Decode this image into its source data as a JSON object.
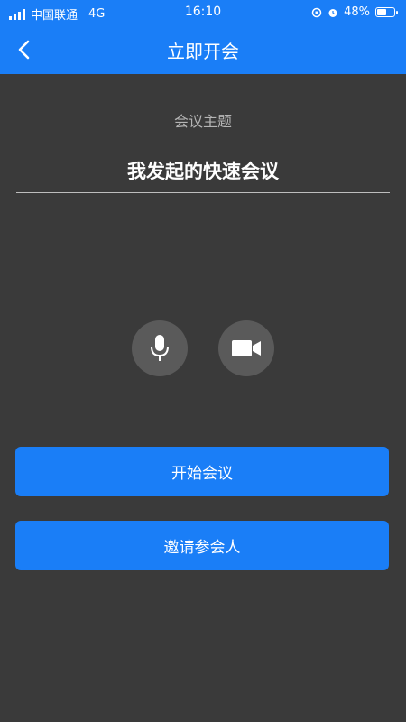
{
  "status_bar": {
    "carrier": "中国联通",
    "network": "4G",
    "time": "16:10",
    "battery": "48%",
    "battery_level": 0.48
  },
  "nav": {
    "title": "立即开会",
    "back_icon": "chevron-left-icon"
  },
  "form": {
    "topic_label": "会议主题",
    "topic_value": "我发起的快速会议"
  },
  "media": {
    "mic_icon": "microphone-icon",
    "camera_icon": "video-camera-icon"
  },
  "actions": {
    "start_label": "开始会议",
    "invite_label": "邀请参会人"
  },
  "colors": {
    "accent": "#1a7ef7",
    "background": "#3a3a3a",
    "media_button": "#5a5a5a"
  }
}
